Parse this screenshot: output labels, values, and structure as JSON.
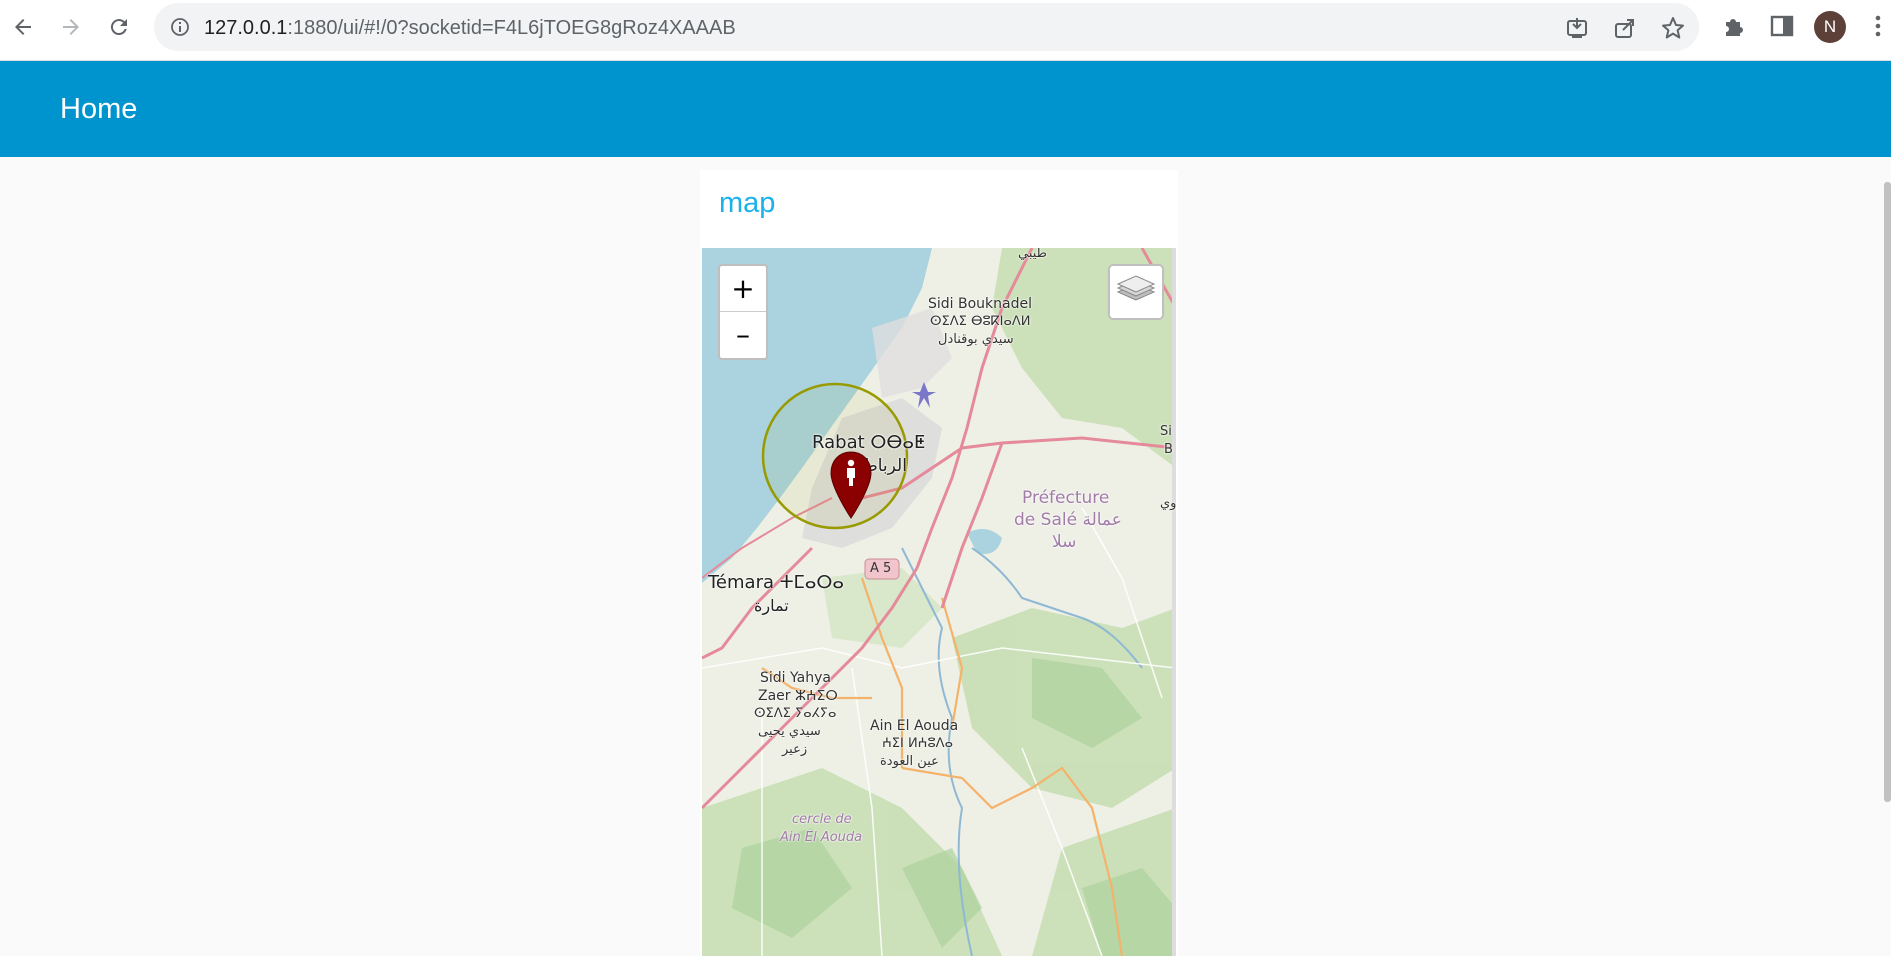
{
  "browser": {
    "url_host": "127.0.0.1",
    "url_path": ":1880/ui/#!/0?socketid=F4L6jTOEG8gRoz4XAAAB",
    "profile_initial": "N"
  },
  "header": {
    "title": "Home"
  },
  "card": {
    "title": "map"
  },
  "map": {
    "zoom_in_label": "+",
    "zoom_out_label": "–",
    "labels": {
      "sidi_bouknadel_1": "Sidi Bouknadel",
      "sidi_bouknadel_2": "ⵙⵉⴷⵉ ⴱⵓⴽⵏⴰⴷⵍ",
      "sidi_bouknadel_3": "سيدي بوقنادل",
      "tayebi": "طيبي",
      "rabat_1": "Rabat ⵔⴱⴰⵟ",
      "rabat_2": "الرباط",
      "prefecture_1": "Préfecture",
      "prefecture_2": "de Salé عمالة",
      "prefecture_3": "سلا",
      "temara_1": "Témara ⵜⵎⴰⵔⴰ",
      "temara_2": "تمارة",
      "a5": "A 5",
      "sidi_yahya_1": "Sidi Yahya",
      "sidi_yahya_2": "Zaer ⵣⵄⵉⵔ",
      "sidi_yahya_3": "ⵙⵉⴷⵉ ⵢⴰⵃⵢⴰ",
      "sidi_yahya_4": "سيدي يحيى",
      "sidi_yahya_5": "زعير",
      "ain_aouda_1": "Ain El Aouda",
      "ain_aouda_2": "ⵄⵉⵏ ⵍⵄⵓⴷⴰ",
      "ain_aouda_3": "عين العودة",
      "cercle_1": "cercle de",
      "cercle_2": "Ain El Aouda",
      "edge_si": "Si",
      "edge_b": "B",
      "edge_ar": "وي"
    },
    "colors": {
      "sea": "#aad3df",
      "land": "#f2efe9",
      "forest": "#add19e",
      "motorway": "#e892a2",
      "primary": "#fcd6a4",
      "marker": "#8b0000",
      "circle": "#999900"
    }
  }
}
